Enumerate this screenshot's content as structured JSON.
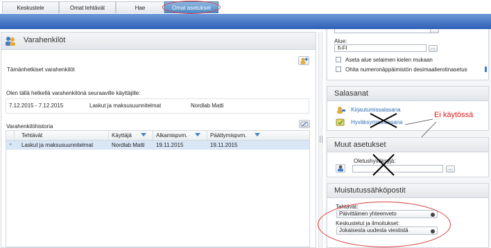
{
  "tabs": [
    {
      "label": "Keskustele",
      "active": false
    },
    {
      "label": "Omat tehtävät",
      "active": false
    },
    {
      "label": "Hae",
      "active": false
    },
    {
      "label": "Omat asetukset",
      "active": true
    }
  ],
  "left_panel": {
    "title": "Varahenkilöt",
    "deputies_label": "Tämänhetkiset varahenkilöt",
    "current_text": "Olen tällä hetkellä varahenkilönä seuraaville käyttäjille:",
    "current_row": {
      "dates": "7.12.2015 - 7.12.2015",
      "task": "Laskut ja maksusuunnitelmat",
      "user": "Nordlab Matti"
    },
    "history_label": "Varahenkilöhistoria",
    "history_headers": [
      "Tehtävät",
      "Käyttäjä",
      "Alkamispvm.",
      "Päättymispvm."
    ],
    "history_rows": [
      {
        "task": "Laskut ja maksusuunnitelmat",
        "user": "Nordlab Matti",
        "start": "19.11.2015",
        "end": "19.11.2015"
      }
    ]
  },
  "right_panel": {
    "alue_label": "Alue:",
    "alue_value": "fi-FI",
    "alue_button": "...",
    "checkboxes": [
      {
        "label": "Aseta alue selaimen kielen mukaan",
        "checked": false
      },
      {
        "label": "Ohita numeronäppäimistön desimaalierotinasetus",
        "checked": false
      }
    ],
    "salasanat": {
      "title": "Salasanat",
      "links": [
        "Kirjautumissalasana",
        "Hyväksymissalasana"
      ]
    },
    "annotation": "Ei käytössä",
    "muut": {
      "title": "Muut asetukset",
      "field_label": "Oletushyväksyjä:",
      "field_value": "",
      "button": "..."
    },
    "muistutus": {
      "title": "Muistutussähköpostit",
      "tehtavat_label": "Tehtävät:",
      "tehtavat_value": "Päivittäinen yhteenveto",
      "keskustelut_label": "Keskustelut ja ilmoitukset:",
      "keskustelut_value": "Jokaisesta uudesta viestistä"
    }
  },
  "colors": {
    "accent": "#2f6fb5",
    "annotation": "#e21b1b",
    "band": "#2c5fb8"
  }
}
